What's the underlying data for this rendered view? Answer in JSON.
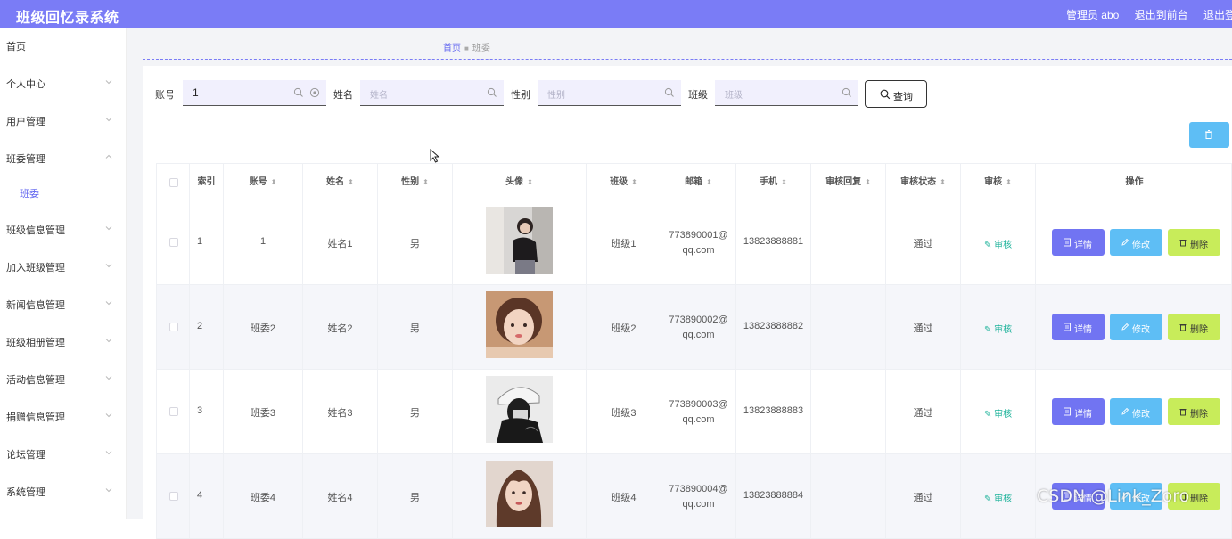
{
  "header": {
    "title": "班级回忆录系统",
    "admin_label": "管理员 abo",
    "front_link": "退出到前台",
    "logout_link": "退出登录"
  },
  "sidebar": {
    "items": [
      {
        "label": "首页",
        "has_chevron": false
      },
      {
        "label": "个人中心",
        "has_chevron": true
      },
      {
        "label": "用户管理",
        "has_chevron": true
      },
      {
        "label": "班委管理",
        "has_chevron": true,
        "expanded": true
      },
      {
        "label": "班委",
        "sub": true
      },
      {
        "label": "班级信息管理",
        "has_chevron": true
      },
      {
        "label": "加入班级管理",
        "has_chevron": true
      },
      {
        "label": "新闻信息管理",
        "has_chevron": true
      },
      {
        "label": "班级相册管理",
        "has_chevron": true
      },
      {
        "label": "活动信息管理",
        "has_chevron": true
      },
      {
        "label": "捐赠信息管理",
        "has_chevron": true
      },
      {
        "label": "论坛管理",
        "has_chevron": true
      },
      {
        "label": "系统管理",
        "has_chevron": true
      }
    ]
  },
  "breadcrumb": {
    "home": "首页",
    "current": "班委"
  },
  "search": {
    "account_label": "账号",
    "account_value": "1",
    "name_label": "姓名",
    "name_placeholder": "姓名",
    "gender_label": "性别",
    "gender_placeholder": "性别",
    "class_label": "班级",
    "class_placeholder": "班级",
    "query_button": "查询"
  },
  "table": {
    "columns": [
      "索引",
      "账号",
      "姓名",
      "性别",
      "头像",
      "班级",
      "邮箱",
      "手机",
      "审核回复",
      "审核状态",
      "审核",
      "操作"
    ],
    "rows": [
      {
        "index": "1",
        "account": "1",
        "name": "姓名1",
        "gender": "男",
        "class": "班级1",
        "email_1": "773890001@",
        "email_2": "qq.com",
        "phone": "13823888881",
        "reply": "",
        "status": "通过",
        "audit": "审核"
      },
      {
        "index": "2",
        "account": "班委2",
        "name": "姓名2",
        "gender": "男",
        "class": "班级2",
        "email_1": "773890002@",
        "email_2": "qq.com",
        "phone": "13823888882",
        "reply": "",
        "status": "通过",
        "audit": "审核"
      },
      {
        "index": "3",
        "account": "班委3",
        "name": "姓名3",
        "gender": "男",
        "class": "班级3",
        "email_1": "773890003@",
        "email_2": "qq.com",
        "phone": "13823888883",
        "reply": "",
        "status": "通过",
        "audit": "审核"
      },
      {
        "index": "4",
        "account": "班委4",
        "name": "姓名4",
        "gender": "男",
        "class": "班级4",
        "email_1": "773890004@",
        "email_2": "qq.com",
        "phone": "13823888884",
        "reply": "",
        "status": "通过",
        "audit": "审核"
      }
    ],
    "actions": {
      "detail": "详情",
      "edit": "修改",
      "delete": "删除"
    }
  },
  "watermark": "CSDN @Link_Zoro",
  "colors": {
    "header": "#7a7cf6",
    "detail": "#7174f2",
    "edit": "#5ebef5",
    "delete": "#c8ec5a",
    "audit": "#1fb39b"
  }
}
